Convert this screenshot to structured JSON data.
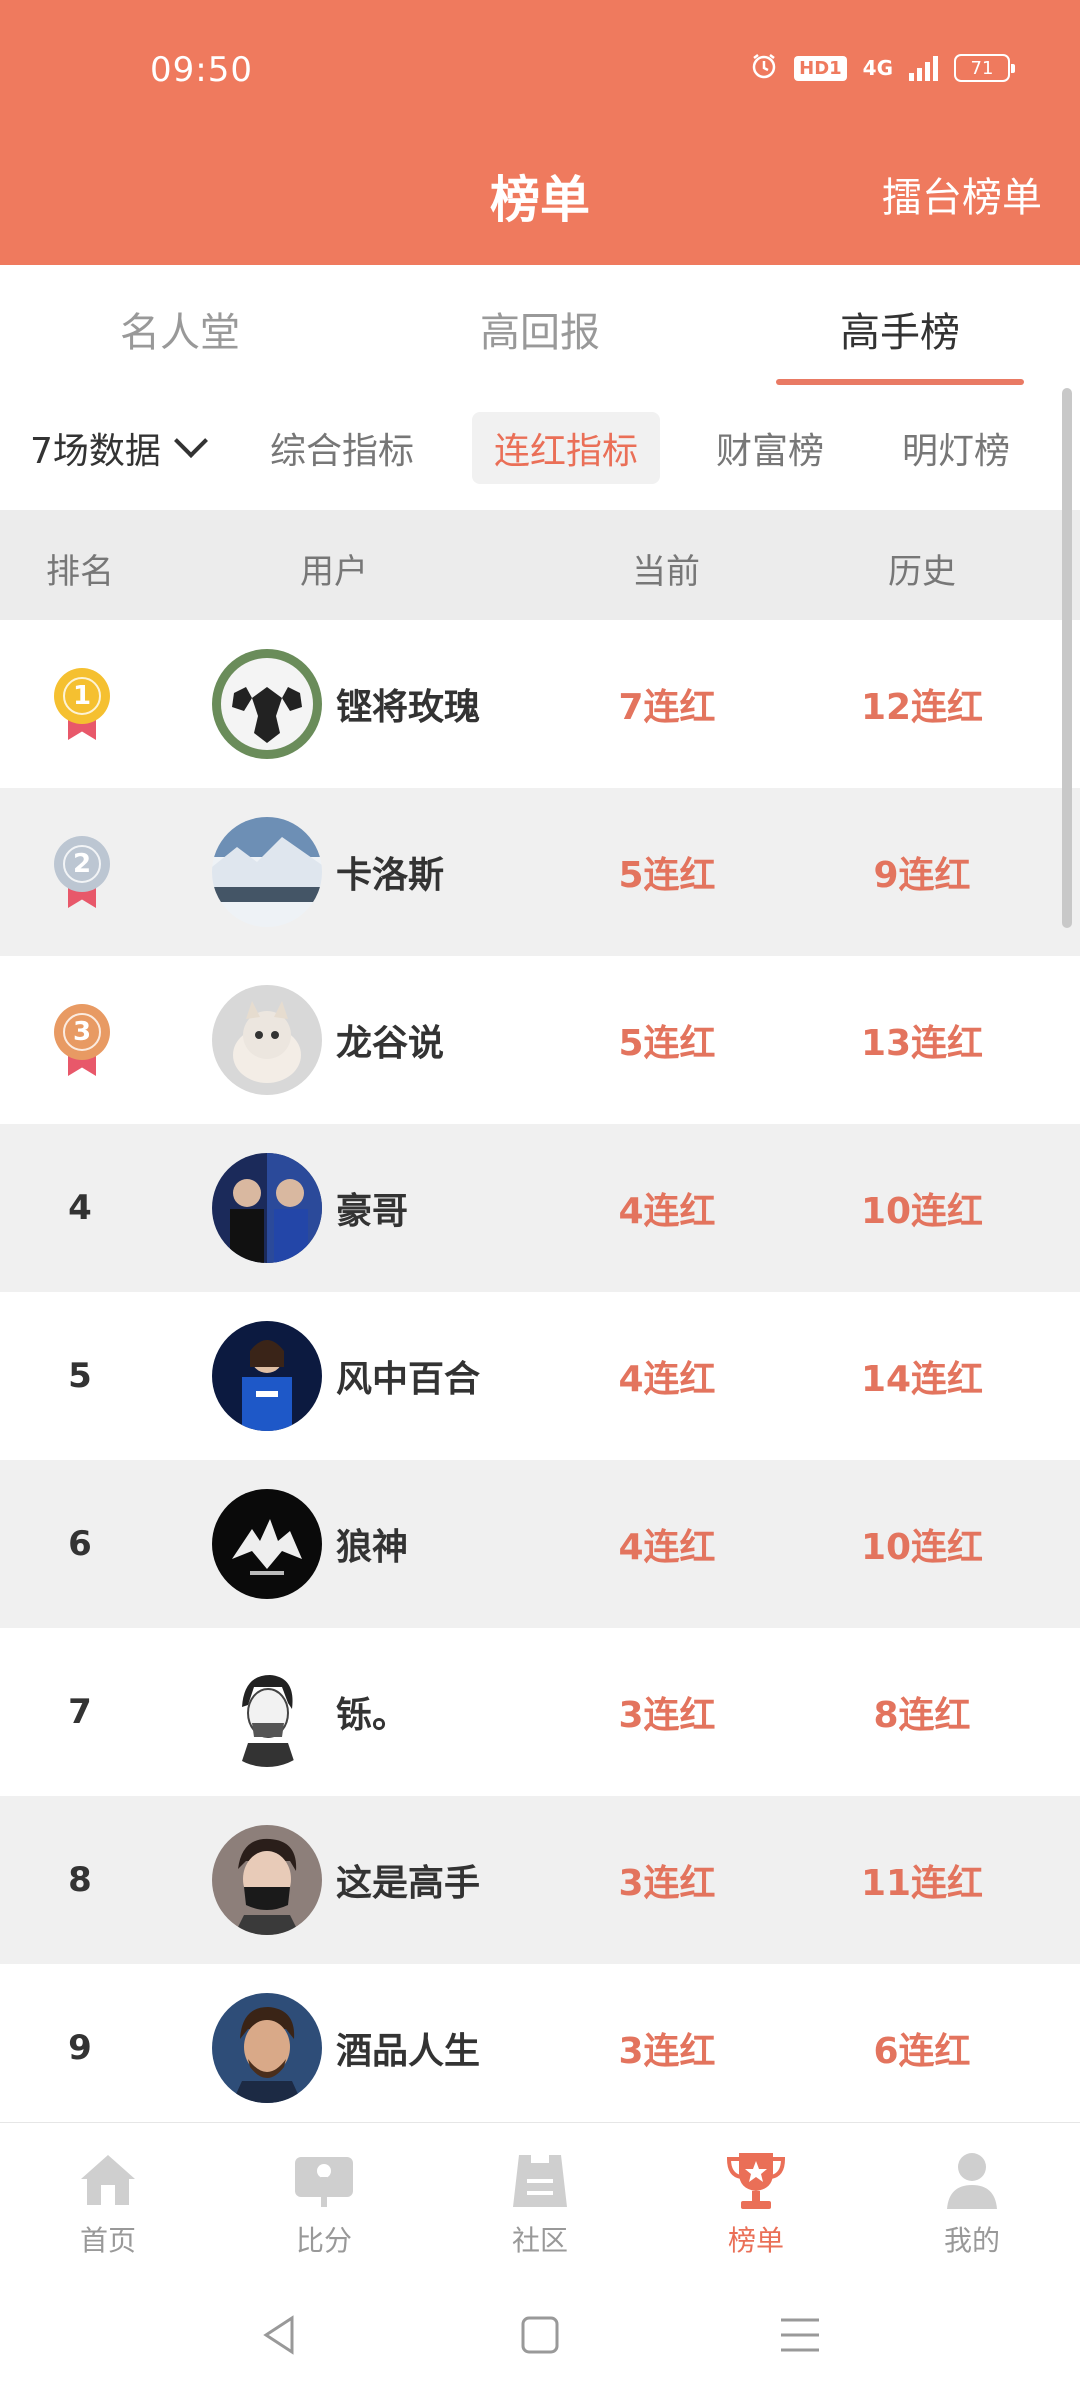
{
  "status_bar": {
    "time": "09:50",
    "hd": "HD1",
    "network": "4G",
    "battery": "71"
  },
  "header": {
    "title": "榜单",
    "action": "擂台榜单"
  },
  "main_tabs": [
    {
      "label": "名人堂",
      "active": false
    },
    {
      "label": "高回报",
      "active": false
    },
    {
      "label": "高手榜",
      "active": true
    }
  ],
  "filters": {
    "range": "7场数据",
    "items": [
      {
        "label": "综合指标",
        "active": false
      },
      {
        "label": "连红指标",
        "active": true
      },
      {
        "label": "财富榜",
        "active": false
      },
      {
        "label": "明灯榜",
        "active": false
      }
    ]
  },
  "table": {
    "headers": {
      "rank": "排名",
      "user": "用户",
      "current": "当前",
      "history": "历史"
    },
    "rows": [
      {
        "rank": "1",
        "medal": "gold",
        "name": "铿将玫瑰",
        "current": "7连红",
        "history": "12连红",
        "avatar": "soccer-ball"
      },
      {
        "rank": "2",
        "medal": "silver",
        "name": "卡洛斯",
        "current": "5连红",
        "history": "9连红",
        "avatar": "snowy-landscape"
      },
      {
        "rank": "3",
        "medal": "bronze",
        "name": "龙谷说",
        "current": "5连红",
        "history": "13连红",
        "avatar": "kitten"
      },
      {
        "rank": "4",
        "medal": null,
        "name": "豪哥",
        "current": "4连红",
        "history": "10连红",
        "avatar": "football-fans"
      },
      {
        "rank": "5",
        "medal": null,
        "name": "风中百合",
        "current": "4连红",
        "history": "14连红",
        "avatar": "blue-jersey"
      },
      {
        "rank": "6",
        "medal": null,
        "name": "狼神",
        "current": "4连红",
        "history": "10连红",
        "avatar": "wolf-logo"
      },
      {
        "rank": "7",
        "medal": null,
        "name": "铄。",
        "current": "3连红",
        "history": "8连红",
        "avatar": "sketch-portrait"
      },
      {
        "rank": "8",
        "medal": null,
        "name": "这是高手",
        "current": "3连红",
        "history": "11连红",
        "avatar": "masked-man"
      },
      {
        "rank": "9",
        "medal": null,
        "name": "酒品人生",
        "current": "3连红",
        "history": "6连红",
        "avatar": "player-portrait"
      }
    ]
  },
  "bottom_nav": [
    {
      "label": "首页",
      "icon": "home-icon",
      "active": false
    },
    {
      "label": "比分",
      "icon": "score-icon",
      "active": false
    },
    {
      "label": "社区",
      "icon": "community-icon",
      "active": false
    },
    {
      "label": "榜单",
      "icon": "trophy-icon",
      "active": true
    },
    {
      "label": "我的",
      "icon": "profile-icon",
      "active": false
    }
  ],
  "colors": {
    "header_bg": "#ef7a5e",
    "accent": "#e3745e",
    "row_alt": "#f0f0f0"
  }
}
